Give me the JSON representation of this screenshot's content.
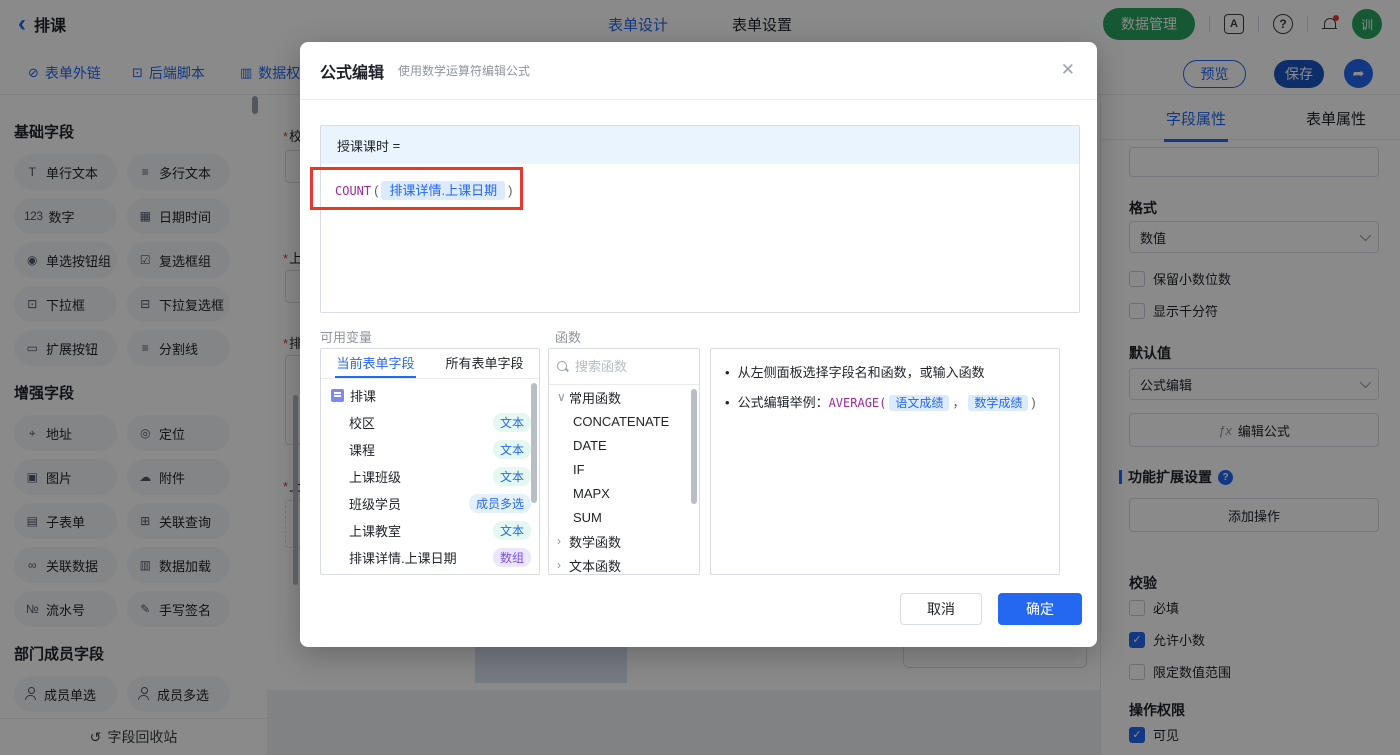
{
  "colors": {
    "accent": "#2468f2",
    "green": "#2aa35f",
    "annotation": "#e8382d",
    "fn-purple": "#a626a4",
    "token-bg": "#dbeafd",
    "token-text": "#2468f2",
    "tag-text-bg": "#e4f8f1",
    "tag-member-bg": "#e2f1fd",
    "tag-array-bg": "#ece6fd",
    "tag-array-text": "#7a4df0",
    "formula-head-bg": "#e9f4fe"
  },
  "topbar": {
    "back_label": "排课",
    "tab_design": "表单设计",
    "tab_settings": "表单设置",
    "data_manage_label": "数据管理",
    "contacts_icon_text": "A",
    "avatar_text": "训"
  },
  "toolbar": {
    "form_link": "表单外链",
    "backend_script": "后端脚本",
    "data_perm": "数据权",
    "preview_label": "预览",
    "save_label": "保存",
    "share_icon": "➦",
    "form_link_icon": "⊘",
    "backend_script_icon": "⊡",
    "data_perm_icon": "▥"
  },
  "palette": {
    "basic": {
      "title": "基础字段",
      "fields": [
        {
          "icon": "T",
          "label": "单行文本"
        },
        {
          "icon": "≡",
          "label": "多行文本"
        },
        {
          "icon": "123",
          "label": "数字"
        },
        {
          "icon": "▦",
          "label": "日期时间"
        },
        {
          "icon": "◉",
          "label": "单选按钮组"
        },
        {
          "icon": "☑",
          "label": "复选框组"
        },
        {
          "icon": "⊡",
          "label": "下拉框"
        },
        {
          "icon": "⊟",
          "label": "下拉复选框"
        },
        {
          "icon": "▭",
          "label": "扩展按钮"
        },
        {
          "icon": "≡",
          "label": "分割线"
        }
      ]
    },
    "enhanced": {
      "title": "增强字段",
      "fields": [
        {
          "icon": "⌖",
          "label": "地址"
        },
        {
          "icon": "◎",
          "label": "定位"
        },
        {
          "icon": "▣",
          "label": "图片"
        },
        {
          "icon": "☁",
          "label": "附件"
        },
        {
          "icon": "▤",
          "label": "子表单"
        },
        {
          "icon": "⊞",
          "label": "关联查询"
        },
        {
          "icon": "∞",
          "label": "关联数据"
        },
        {
          "icon": "▥",
          "label": "数据加载"
        },
        {
          "icon": "№",
          "label": "流水号"
        },
        {
          "icon": "✎",
          "label": "手写签名"
        }
      ]
    },
    "member": {
      "title": "部门成员字段",
      "fields": [
        {
          "variant": "single",
          "label": "成员单选"
        },
        {
          "variant": "multi",
          "label": "成员多选"
        }
      ]
    },
    "recycle_label": "字段回收站",
    "recycle_icon": "↺"
  },
  "canvas": {
    "required_mark": "*",
    "partial_labels": [
      "校",
      "上",
      "排",
      "上"
    ]
  },
  "modal": {
    "title": "公式编辑",
    "subtitle": "使用数学运算符编辑公式",
    "close_icon": "✕",
    "formula": {
      "target_field": "授课课时",
      "equals": "=",
      "function_name": "COUNT",
      "open_paren": "(",
      "token": "排课详情.上课日期",
      "close_paren": ")"
    },
    "variables": {
      "label": "可用变量",
      "tab_current": "当前表单字段",
      "tab_all": "所有表单字段",
      "root": "排课",
      "rows": [
        {
          "name": "校区",
          "tag": "文本",
          "tag_kind": "text"
        },
        {
          "name": "课程",
          "tag": "文本",
          "tag_kind": "text"
        },
        {
          "name": "上课班级",
          "tag": "文本",
          "tag_kind": "text"
        },
        {
          "name": "班级学员",
          "tag": "成员多选",
          "tag_kind": "member"
        },
        {
          "name": "上课教室",
          "tag": "文本",
          "tag_kind": "text"
        },
        {
          "name": "排课详情.上课日期",
          "tag": "数组",
          "tag_kind": "array"
        }
      ]
    },
    "functions": {
      "label": "函数",
      "search_placeholder": "搜索函数",
      "rows": [
        {
          "kind": "group",
          "chevron": "∨",
          "name": "常用函数"
        },
        {
          "kind": "item",
          "chevron": "",
          "name": "CONCATENATE"
        },
        {
          "kind": "item",
          "chevron": "",
          "name": "DATE"
        },
        {
          "kind": "item",
          "chevron": "",
          "name": "IF"
        },
        {
          "kind": "item",
          "chevron": "",
          "name": "MAPX"
        },
        {
          "kind": "item",
          "chevron": "",
          "name": "SUM"
        },
        {
          "kind": "group",
          "chevron": "›",
          "name": "数学函数"
        },
        {
          "kind": "group",
          "chevron": "›",
          "name": "文本函数"
        }
      ]
    },
    "help": {
      "bullet": "•",
      "line1": "从左侧面板选择字段名和函数，或输入函数",
      "line2_prefix": "公式编辑举例：",
      "line2_fn": "AVERAGE(",
      "line2_token1": "语文成绩",
      "line2_comma": "，",
      "line2_token2": "数学成绩",
      "line2_close": ")"
    },
    "cancel_label": "取消",
    "confirm_label": "确定"
  },
  "properties": {
    "tab_field": "字段属性",
    "tab_form": "表单属性",
    "title_input_value": "",
    "format_label": "格式",
    "format_value": "数值",
    "format_options": [
      {
        "label": "保留小数位数",
        "checked": false
      },
      {
        "label": "显示千分符",
        "checked": false
      }
    ],
    "default_label": "默认值",
    "default_value": "公式编辑",
    "fx_icon": "ƒx",
    "edit_formula_label": "编辑公式",
    "extension_title": "功能扩展设置",
    "add_action_label": "添加操作",
    "validation_title": "校验",
    "validation_options": [
      {
        "label": "必填",
        "checked": false
      },
      {
        "label": "允许小数",
        "checked": true
      },
      {
        "label": "限定数值范围",
        "checked": false
      }
    ],
    "permission_title": "操作权限",
    "permission_options": [
      {
        "label": "可见",
        "checked": true
      }
    ]
  }
}
